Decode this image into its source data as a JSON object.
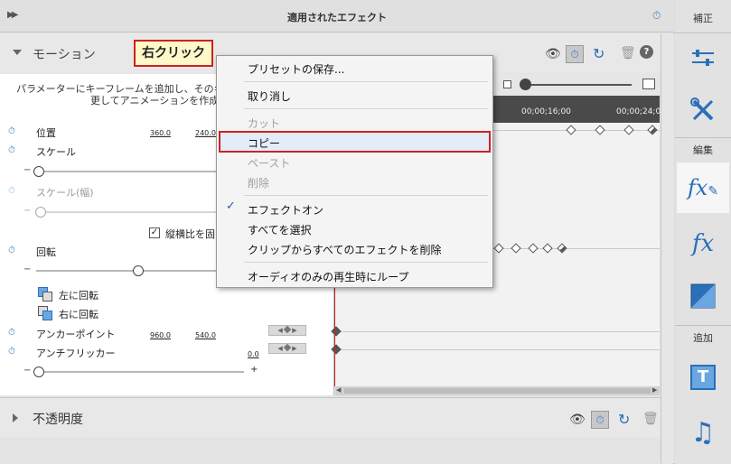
{
  "panel": {
    "title": "適用されたエフェクト",
    "collapse_icon": "double-chevron-right-icon",
    "timer_icon": "stopwatch-icon"
  },
  "callout": "右クリック",
  "motion": {
    "label": "モーション",
    "description_line1": "パラメーターにキーフレームを追加し、そのキーフ",
    "description_line2": "更してアニメーションを作成しま",
    "params": {
      "position": {
        "label": "位置",
        "x": "360.0",
        "y": "240.0"
      },
      "scale": {
        "label": "スケール"
      },
      "scale_width": {
        "label": "スケール(幅)"
      },
      "uniform_scale": {
        "label": "縦横比を固",
        "checked": true
      },
      "rotation": {
        "label": "回転"
      },
      "rotate_left": "左に回転",
      "rotate_right": "右に回転",
      "anchor": {
        "label": "アンカーポイント",
        "x": "960.0",
        "y": "540.0"
      },
      "antiflicker": {
        "label": "アンチフリッカー",
        "value": "0.0",
        "plus": "+"
      },
      "minus": "−"
    }
  },
  "timeline": {
    "ticks": [
      "00;00;16;00",
      "00;00;24;0"
    ]
  },
  "opacity": {
    "label": "不透明度"
  },
  "context_menu": {
    "items": [
      {
        "label": "プリセットの保存...",
        "enabled": true
      },
      {
        "label": "取り消し",
        "enabled": true
      },
      {
        "label": "カット",
        "enabled": false
      },
      {
        "label": "コピー",
        "enabled": true,
        "highlighted": true
      },
      {
        "label": "ペースト",
        "enabled": false
      },
      {
        "label": "削除",
        "enabled": false
      },
      {
        "label": "エフェクトオン",
        "enabled": true,
        "checked": true
      },
      {
        "label": "すべてを選択",
        "enabled": true
      },
      {
        "label": "クリップからすべてのエフェクトを削除",
        "enabled": true
      },
      {
        "label": "オーディオのみの再生時にループ",
        "enabled": true
      }
    ]
  },
  "right_bar": {
    "section_adjust": "補正",
    "section_edit": "編集",
    "section_add": "追加",
    "tools": [
      "sliders-icon",
      "wrench-screwdriver-icon",
      "fx-edit-icon",
      "fx-icon",
      "transition-icon",
      "title-text-icon",
      "music-note-icon"
    ]
  },
  "colors": {
    "accent": "#3a7ac8",
    "highlight_border": "#cc2222",
    "callout_bg": "#fff8c8"
  }
}
